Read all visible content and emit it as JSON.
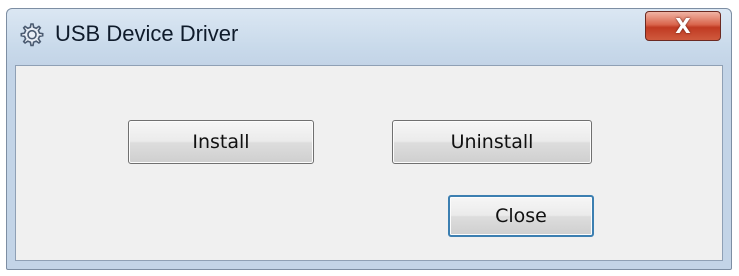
{
  "window": {
    "title": "USB Device Driver",
    "title_icon": "gear-icon",
    "close_glyph": "X"
  },
  "buttons": {
    "install": "Install",
    "uninstall": "Uninstall",
    "close": "Close"
  }
}
